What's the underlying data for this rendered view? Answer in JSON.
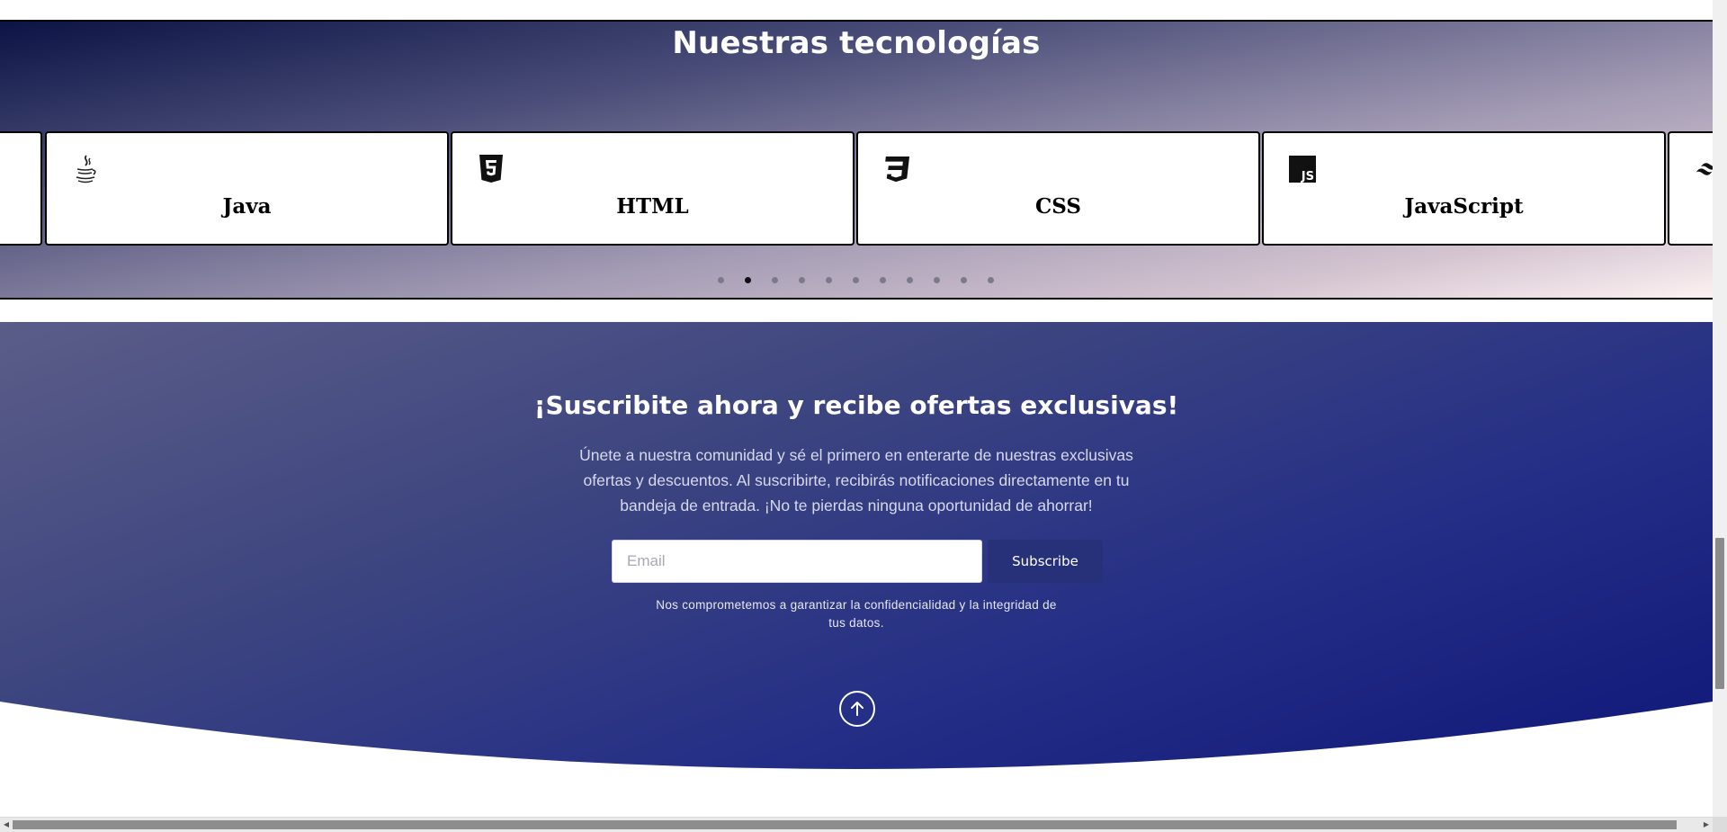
{
  "technologies": {
    "title": "Nuestras tecnologías",
    "cards": [
      {
        "label": "",
        "icon": "blank"
      },
      {
        "label": "Java",
        "icon": "java-icon"
      },
      {
        "label": "HTML",
        "icon": "html5-icon"
      },
      {
        "label": "CSS",
        "icon": "css3-icon"
      },
      {
        "label": "JavaScript",
        "icon": "javascript-icon"
      },
      {
        "label": "",
        "icon": "tailwind-icon"
      }
    ],
    "pagination": {
      "total": 11,
      "active": 2
    }
  },
  "subscribe": {
    "title": "¡Suscribite ahora y recibe ofertas exclusivas!",
    "description": "Únete a nuestra comunidad y sé el primero en enterarte de nuestras exclusivas ofertas y descuentos. Al suscribirte, recibirás notificaciones directamente en tu bandeja de entrada. ¡No te pierdas ninguna oportunidad de ahorrar!",
    "email_placeholder": "Email",
    "button_label": "Subscribe",
    "privacy_note": "Nos comprometemos a garantizar la confidencialidad y la integridad de tus datos."
  },
  "colors": {
    "subscribe_bg_start": "#5b5d88",
    "subscribe_bg_end": "#0f1679",
    "button_bg": "#26317a"
  }
}
